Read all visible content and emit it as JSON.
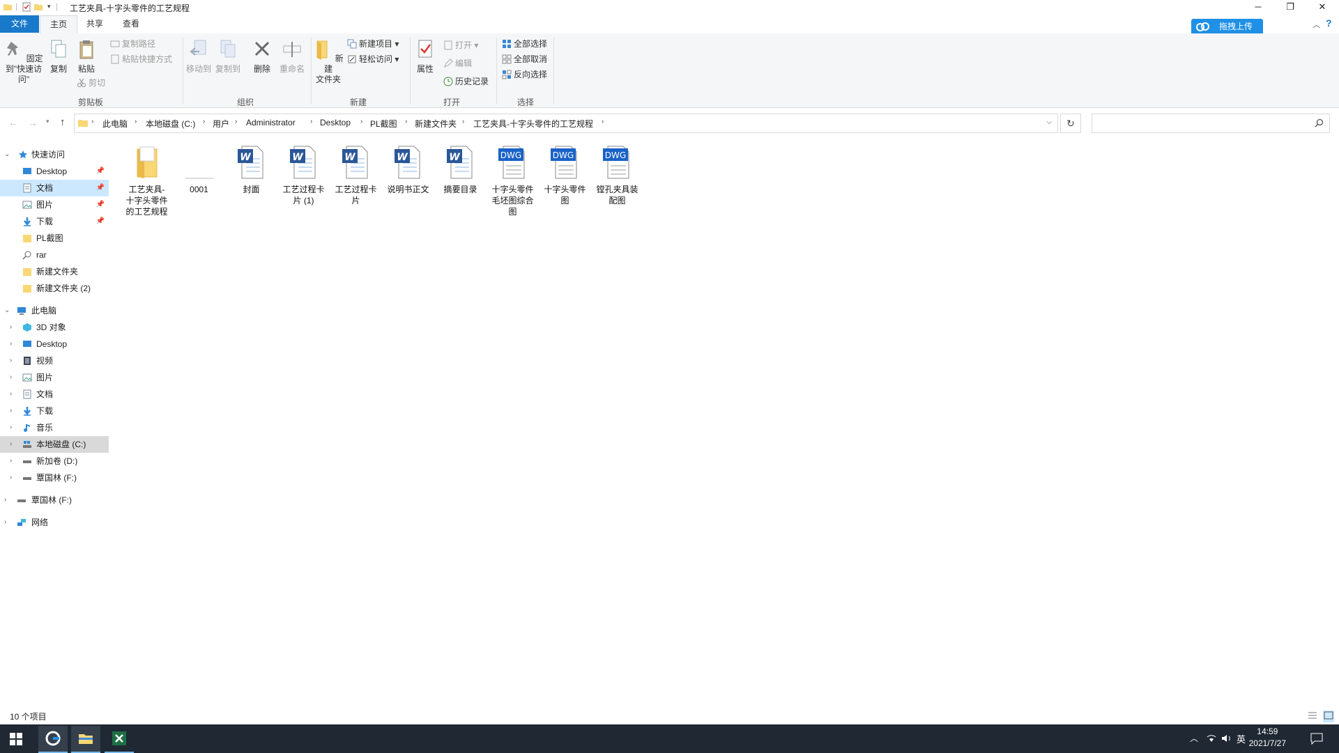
{
  "window": {
    "title": "工艺夹具-十字头零件的工艺规程"
  },
  "upload_button": "拖拽上传",
  "tabs": [
    "文件",
    "主页",
    "共享",
    "查看"
  ],
  "ribbon": {
    "clipboard": {
      "label": "剪贴板",
      "pin": "固定到\"快速访问\"",
      "copy": "复制",
      "paste": "粘贴",
      "copy_path": "复制路径",
      "paste_shortcut": "粘贴快捷方式",
      "cut": "剪切"
    },
    "organize": {
      "label": "组织",
      "move_to": "移动到",
      "copy_to": "复制到",
      "delete": "删除",
      "rename": "重命名"
    },
    "new": {
      "label": "新建",
      "new_folder": "新建\n文件夹",
      "new_item": "新建项目",
      "easy_access": "轻松访问"
    },
    "open": {
      "label": "打开",
      "properties": "属性",
      "open": "打开",
      "edit": "编辑",
      "history": "历史记录"
    },
    "select": {
      "label": "选择",
      "select_all": "全部选择",
      "select_none": "全部取消",
      "invert": "反向选择"
    }
  },
  "breadcrumbs": [
    "此电脑",
    "本地磁盘 (C:)",
    "用户",
    "Administrator",
    "Desktop",
    "PL截图",
    "新建文件夹",
    "工艺夹具-十字头零件的工艺规程"
  ],
  "nav": {
    "quick_access": "快速访问",
    "quick_items": [
      "Desktop",
      "文档",
      "图片",
      "下载",
      "PL截图",
      "rar",
      "新建文件夹",
      "新建文件夹 (2)"
    ],
    "this_pc": "此电脑",
    "pc_items": [
      "3D 对象",
      "Desktop",
      "视频",
      "图片",
      "文档",
      "下载",
      "音乐",
      "本地磁盘 (C:)",
      "新加卷 (D:)",
      "覃国林 (F:)"
    ],
    "extra_drive": "覃国林 (F:)",
    "network": "网络"
  },
  "files": [
    {
      "name": "工艺夹具-\n十字头零件\n的工艺规程",
      "type": "folder"
    },
    {
      "name": "0001",
      "type": "blank"
    },
    {
      "name": "封面",
      "type": "word"
    },
    {
      "name": "工艺过程卡\n片 (1)",
      "type": "word"
    },
    {
      "name": "工艺过程卡\n片",
      "type": "word"
    },
    {
      "name": "说明书正文",
      "type": "word"
    },
    {
      "name": "摘要目录",
      "type": "word"
    },
    {
      "name": "十字头零件\n毛坯图综合\n图",
      "type": "dwg"
    },
    {
      "name": "十字头零件\n图",
      "type": "dwg"
    },
    {
      "name": "镗孔夹具装\n配图",
      "type": "dwg"
    }
  ],
  "icon_text": {
    "word": "W",
    "dwg": "DWG"
  },
  "status": "10 个项目",
  "taskbar": {
    "time": "14:59",
    "date": "2021/7/27",
    "lang": "英"
  },
  "colors": {
    "accent": "#1979ca",
    "selection": "#cce8ff",
    "taskbar": "#1f2833"
  }
}
